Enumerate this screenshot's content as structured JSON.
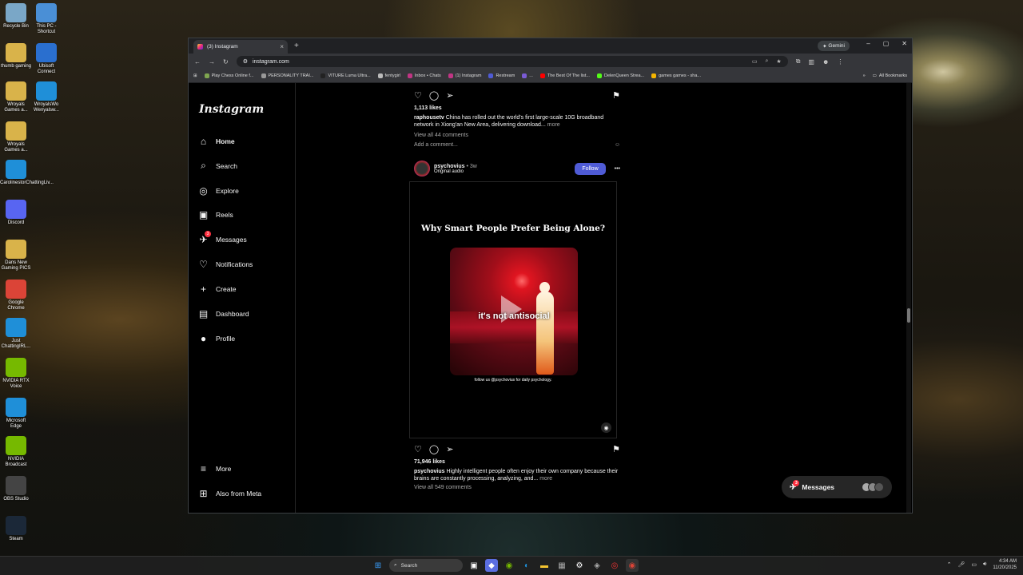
{
  "desktop": {
    "icons": [
      {
        "label": "Recycle Bin",
        "color": "#7aa7c7"
      },
      {
        "label": "This PC - Shortcut",
        "color": "#4a8fd6"
      },
      {
        "label": "thumb gaming",
        "color": "#d9b34a"
      },
      {
        "label": "Ubisoft Connect",
        "color": "#2a6fcf"
      },
      {
        "label": "Wroyals Games a...",
        "color": "#d9b34a"
      },
      {
        "label": "WroyalsWo Wenyalsw...",
        "color": "#1f8fd8"
      },
      {
        "label": "Wroyals Games a...",
        "color": "#d9b34a"
      },
      {
        "label": "CarolinestorChattingLiv...",
        "color": "#1f8fd8"
      },
      {
        "label": "Discord",
        "color": "#5865f2"
      },
      {
        "label": "Dans New Gaming PICS",
        "color": "#d9b34a"
      },
      {
        "label": "Google Chrome",
        "color": "#db4437"
      },
      {
        "label": "Just ChattingIRL...",
        "color": "#1f8fd8"
      },
      {
        "label": "NVIDIA RTX Voice",
        "color": "#76b900"
      },
      {
        "label": "Microsoft Edge",
        "color": "#1f8fd8"
      },
      {
        "label": "NVIDIA Broadcast",
        "color": "#76b900"
      },
      {
        "label": "OBS Studio",
        "color": "#444444"
      },
      {
        "label": "Steam",
        "color": "#1b2838"
      }
    ]
  },
  "browser": {
    "tab_title": "(3) Instagram",
    "new_tab": "+",
    "gemini": "Gemini",
    "window_controls": [
      "–",
      "▢",
      "✕"
    ],
    "url": "instagram.com",
    "bookmarks": [
      {
        "label": "Play Chess Online f...",
        "color": "#7fa650"
      },
      {
        "label": "PERSONALITY TRAI...",
        "color": "#999999"
      },
      {
        "label": "VITURE Luma Ultra...",
        "color": "#222222"
      },
      {
        "label": "fentygirl",
        "color": "#bbbbbb"
      },
      {
        "label": "Inbox • Chats",
        "color": "#c13584"
      },
      {
        "label": "(1) Instagram",
        "color": "#c13584"
      },
      {
        "label": "Restream",
        "color": "#4f5bd5"
      },
      {
        "label": "...",
        "color": "#7a5bd5"
      },
      {
        "label": "The Best Of The list...",
        "color": "#ff0000"
      },
      {
        "label": "DelenQueen Strea...",
        "color": "#53fc18"
      },
      {
        "label": "games games - sha...",
        "color": "#f4b400"
      }
    ],
    "all_bookmarks": "All Bookmarks",
    "more_bookmarks": "»"
  },
  "instagram": {
    "logo": "Instagram",
    "nav": [
      {
        "label": "Home",
        "icon": "⌂",
        "name": "home"
      },
      {
        "label": "Search",
        "icon": "⌕",
        "name": "search"
      },
      {
        "label": "Explore",
        "icon": "◎",
        "name": "explore"
      },
      {
        "label": "Reels",
        "icon": "▣",
        "name": "reels"
      },
      {
        "label": "Messages",
        "icon": "✈",
        "name": "messages"
      },
      {
        "label": "Notifications",
        "icon": "♡",
        "name": "notifications"
      },
      {
        "label": "Create",
        "icon": "+",
        "name": "create"
      },
      {
        "label": "Dashboard",
        "icon": "▤",
        "name": "dashboard"
      },
      {
        "label": "Profile",
        "icon": "●",
        "name": "profile"
      }
    ],
    "messages_badge": "3",
    "more": "More",
    "also_from_meta": "Also from Meta",
    "post1": {
      "likes": "1,113 likes",
      "username": "raphousetv",
      "caption": "China has rolled out the world's first large-scale 10G broadband network in Xiong'an New Area, delivering download...",
      "more": "more",
      "comments": "View all 44 comments",
      "add_comment": "Add a comment...",
      "emoji": "☺"
    },
    "post2": {
      "username": "psychovius",
      "time": "• 3w",
      "audio": "Original audio",
      "follow": "Follow",
      "menu": "•••",
      "media_title": "Why Smart People Prefer Being Alone?",
      "media_caption": "it's not antisocial",
      "media_footer": "follow us @psychovius for daily psychology.",
      "likes": "71,946 likes",
      "caption": "Highly intelligent people often enjoy their own company because their brains are constantly processing, analyzing, and...",
      "more": "more",
      "comments": "View all 549 comments"
    },
    "messages_pill": {
      "label": "Messages",
      "badge": "3"
    }
  },
  "taskbar": {
    "search": "Search",
    "time": "4:34 AM",
    "date": "11/20/2025"
  }
}
